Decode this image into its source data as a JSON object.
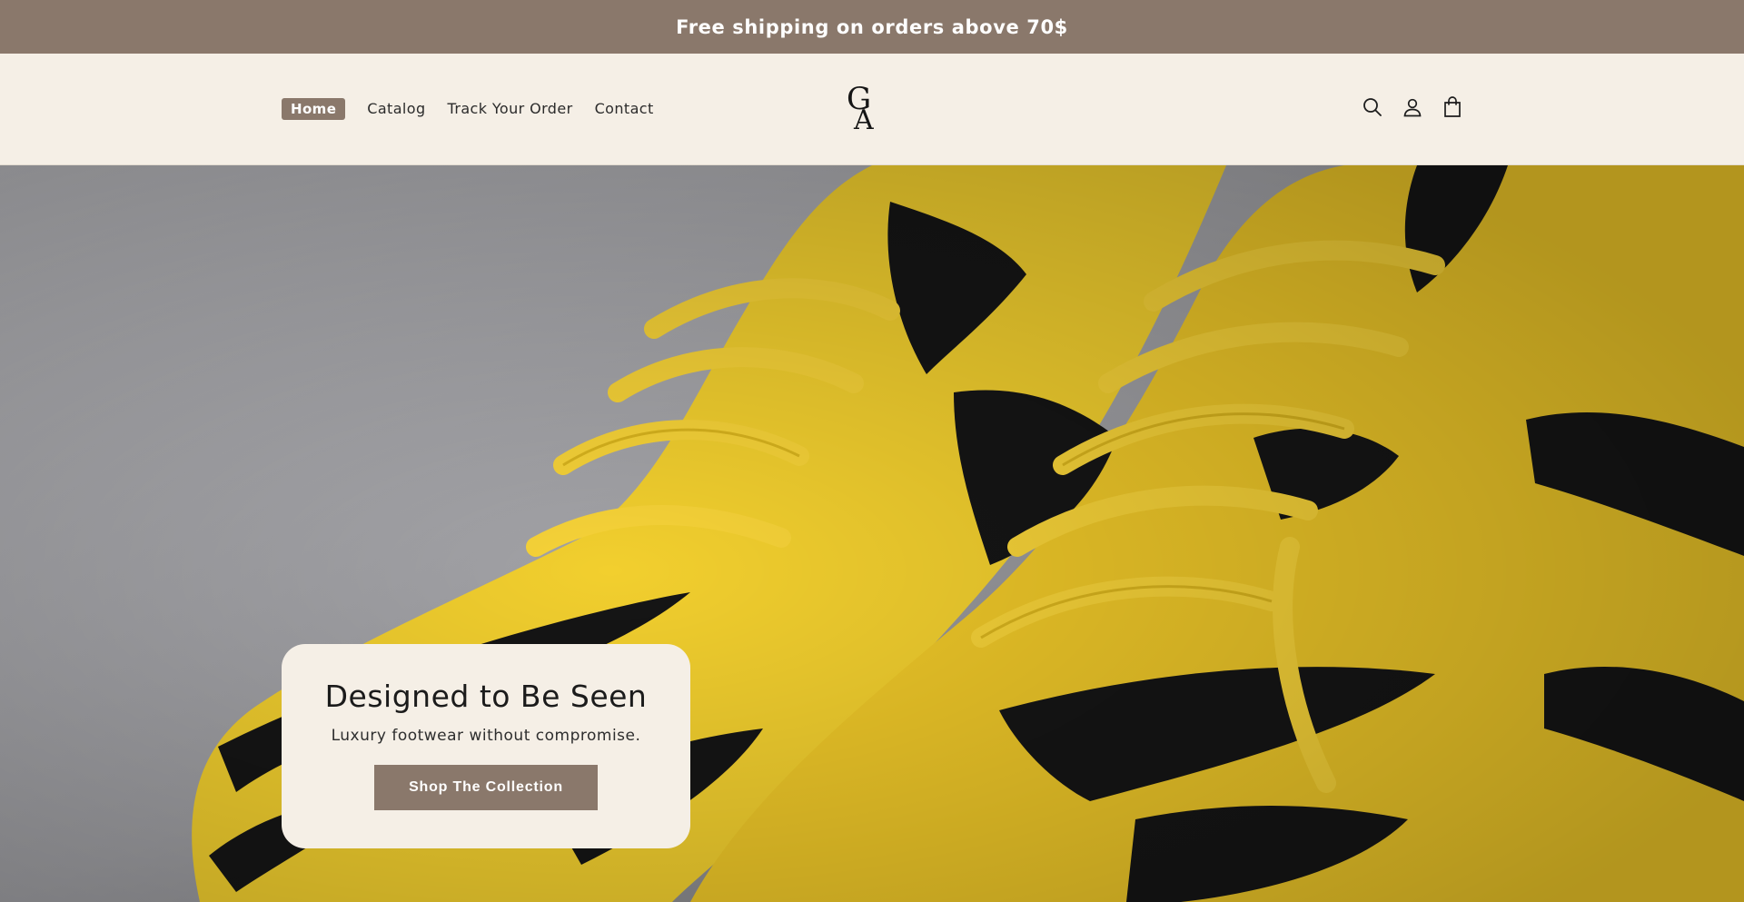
{
  "announcement": {
    "text": "Free shipping on orders above 70$"
  },
  "nav": {
    "items": [
      {
        "label": "Home",
        "active": true
      },
      {
        "label": "Catalog",
        "active": false
      },
      {
        "label": "Track Your Order",
        "active": false
      },
      {
        "label": "Contact",
        "active": false
      }
    ]
  },
  "logo": {
    "icon": "ga-monogram-logo",
    "letters": "GA"
  },
  "header_icons": [
    {
      "name": "search-icon"
    },
    {
      "name": "account-icon"
    },
    {
      "name": "cart-icon"
    }
  ],
  "hero": {
    "image": "yellow-black-sneakers-photo",
    "title": "Designed to Be Seen",
    "subtitle": "Luxury footwear without compromise.",
    "cta_label": "Shop The Collection"
  },
  "colors": {
    "brand": "#8a786b",
    "background": "#f5efe6",
    "text": "#1d1d1d",
    "shoe_yellow": "#f2cf2e",
    "shoe_black": "#151515"
  }
}
